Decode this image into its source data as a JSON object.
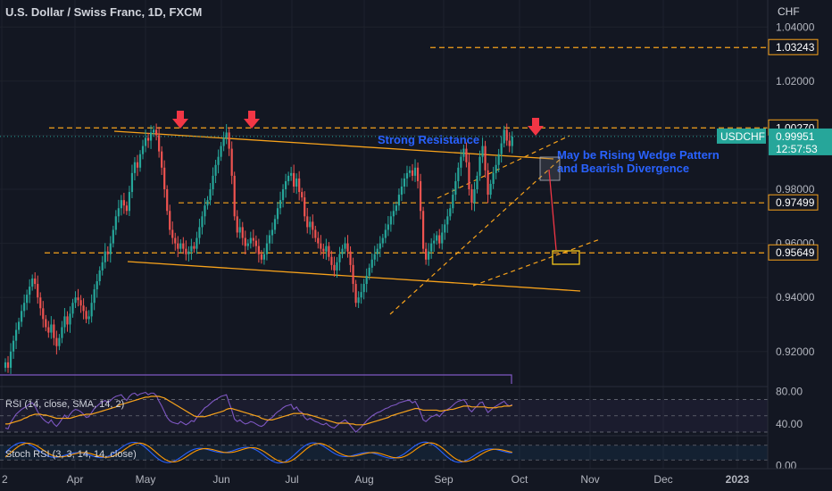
{
  "header": {
    "symbol_title": "U.S. Dollar / Swiss Franc, 1D, FXCM",
    "currency": "CHF"
  },
  "colors": {
    "up": "#26a69a",
    "down": "#ef5350",
    "orange": "#f7a21b",
    "blue_text": "#2962ff",
    "bg": "#131722"
  },
  "chart_data": {
    "type": "candlestick",
    "ylim": [
      0.912,
      1.05
    ],
    "y_ticks": [
      "1.04000",
      "1.02000",
      "1.00000",
      "0.98000",
      "0.96000",
      "0.94000",
      "0.92000"
    ],
    "x_ticks": [
      "2",
      "Apr",
      "May",
      "Jun",
      "Jul",
      "Aug",
      "Sep",
      "Oct",
      "Nov",
      "Dec",
      "2023"
    ],
    "price_labels": [
      {
        "value": 1.03243,
        "text": "1.03243",
        "style": "orange"
      },
      {
        "value": 1.0027,
        "text": "1.00270",
        "style": "orange"
      },
      {
        "value": 0.97499,
        "text": "0.97499",
        "style": "orange"
      },
      {
        "value": 0.95649,
        "text": "0.95649",
        "style": "orange"
      }
    ],
    "current": {
      "symbol": "USDCHF",
      "price": "0.99951",
      "countdown": "12:57:53",
      "value": 0.99951
    },
    "horizontal_levels": [
      1.03243,
      1.0027,
      0.97499,
      0.95649
    ],
    "annotations": {
      "strong_resistance": "Strong Resistance",
      "wedge_line1": "May be Rising Wedge Pattern",
      "wedge_line2": "and Bearish Divergence"
    },
    "arrows_down_at": [
      "May",
      "Jun",
      "Oct"
    ],
    "closes": [
      0.916,
      0.914,
      0.92,
      0.924,
      0.928,
      0.931,
      0.935,
      0.938,
      0.941,
      0.944,
      0.947,
      0.945,
      0.94,
      0.936,
      0.932,
      0.929,
      0.927,
      0.93,
      0.925,
      0.922,
      0.925,
      0.929,
      0.933,
      0.93,
      0.934,
      0.938,
      0.94,
      0.939,
      0.937,
      0.935,
      0.932,
      0.933,
      0.938,
      0.943,
      0.946,
      0.95,
      0.953,
      0.957,
      0.956,
      0.96,
      0.965,
      0.97,
      0.973,
      0.976,
      0.974,
      0.972,
      0.979,
      0.986,
      0.99,
      0.988,
      0.993,
      0.996,
      0.999,
      0.998,
      1.001,
      1.002,
      1.0,
      0.994,
      0.988,
      0.98,
      0.972,
      0.965,
      0.962,
      0.96,
      0.958,
      0.96,
      0.958,
      0.956,
      0.957,
      0.959,
      0.958,
      0.962,
      0.966,
      0.97,
      0.974,
      0.976,
      0.98,
      0.985,
      0.989,
      0.992,
      0.996,
      0.999,
      1.001,
      0.995,
      0.985,
      0.97,
      0.964,
      0.966,
      0.962,
      0.959,
      0.96,
      0.962,
      0.961,
      0.959,
      0.956,
      0.954,
      0.956,
      0.96,
      0.963,
      0.965,
      0.969,
      0.973,
      0.976,
      0.98,
      0.983,
      0.985,
      0.986,
      0.981,
      0.984,
      0.979,
      0.977,
      0.97,
      0.966,
      0.968,
      0.965,
      0.962,
      0.96,
      0.958,
      0.957,
      0.959,
      0.955,
      0.952,
      0.95,
      0.953,
      0.956,
      0.958,
      0.96,
      0.957,
      0.952,
      0.945,
      0.938,
      0.94,
      0.942,
      0.945,
      0.948,
      0.951,
      0.954,
      0.956,
      0.958,
      0.96,
      0.962,
      0.965,
      0.967,
      0.97,
      0.972,
      0.974,
      0.978,
      0.981,
      0.984,
      0.986,
      0.987,
      0.985,
      0.988,
      0.983,
      0.972,
      0.958,
      0.954,
      0.957,
      0.96,
      0.961,
      0.963,
      0.96,
      0.964,
      0.967,
      0.97,
      0.973,
      0.978,
      0.983,
      0.988,
      0.992,
      0.995,
      0.99,
      0.98,
      0.975,
      0.98,
      0.985,
      0.992,
      0.996,
      0.987,
      0.978,
      0.982,
      0.986,
      0.989,
      0.993,
      0.997,
      1.002,
      0.998,
      0.996,
      0.9995
    ],
    "rsi": {
      "label": "RSI (14, close, SMA, 14, 2)",
      "ylim": [
        30,
        85
      ],
      "ticks": [
        "80.00",
        "40.00"
      ],
      "values": [
        35,
        34,
        42,
        47,
        52,
        55,
        58,
        60,
        62,
        65,
        66,
        62,
        55,
        50,
        46,
        43,
        41,
        45,
        40,
        37,
        41,
        46,
        51,
        47,
        52,
        56,
        58,
        57,
        55,
        52,
        48,
        49,
        54,
        59,
        62,
        65,
        67,
        69,
        66,
        69,
        72,
        74,
        75,
        76,
        72,
        69,
        74,
        77,
        78,
        75,
        77,
        78,
        79,
        76,
        78,
        78,
        75,
        68,
        62,
        55,
        48,
        44,
        42,
        41,
        40,
        43,
        41,
        39,
        41,
        44,
        43,
        48,
        52,
        56,
        60,
        62,
        65,
        68,
        70,
        72,
        74,
        75,
        76,
        66,
        57,
        46,
        43,
        45,
        42,
        40,
        41,
        43,
        42,
        40,
        38,
        37,
        39,
        43,
        46,
        48,
        52,
        55,
        57,
        60,
        62,
        63,
        64,
        58,
        61,
        56,
        54,
        48,
        45,
        47,
        45,
        43,
        42,
        40,
        39,
        41,
        38,
        36,
        35,
        38,
        41,
        43,
        45,
        42,
        38,
        34,
        30,
        33,
        36,
        40,
        44,
        47,
        50,
        52,
        54,
        55,
        57,
        59,
        60,
        62,
        63,
        64,
        66,
        67,
        68,
        69,
        69,
        66,
        68,
        62,
        54,
        45,
        43,
        46,
        49,
        50,
        52,
        49,
        53,
        56,
        58,
        60,
        63,
        66,
        68,
        69,
        70,
        66,
        58,
        55,
        59,
        62,
        66,
        67,
        60,
        54,
        57,
        60,
        62,
        64,
        66,
        68,
        64,
        62,
        64
      ],
      "ma": [
        40,
        40,
        41,
        42,
        43,
        44,
        45,
        47,
        48,
        50,
        51,
        52,
        52,
        52,
        51,
        51,
        50,
        49,
        48,
        47,
        47,
        47,
        47,
        47,
        47,
        48,
        49,
        50,
        51,
        51,
        52,
        52,
        52,
        53,
        54,
        55,
        56,
        57,
        58,
        59,
        60,
        61,
        63,
        64,
        65,
        66,
        67,
        68,
        69,
        70,
        71,
        72,
        73,
        73,
        74,
        74,
        74,
        74,
        73,
        72,
        70,
        68,
        66,
        64,
        62,
        60,
        58,
        56,
        54,
        52,
        50,
        49,
        49,
        49,
        49,
        50,
        51,
        52,
        53,
        54,
        55,
        56,
        58,
        59,
        59,
        58,
        57,
        56,
        55,
        54,
        53,
        52,
        51,
        50,
        49,
        47,
        46,
        45,
        45,
        45,
        46,
        47,
        48,
        49,
        50,
        51,
        52,
        53,
        53,
        53,
        53,
        52,
        52,
        51,
        50,
        49,
        48,
        47,
        46,
        45,
        44,
        43,
        42,
        41,
        41,
        41,
        41,
        41,
        40,
        40,
        39,
        39,
        39,
        39,
        40,
        41,
        42,
        43,
        44,
        45,
        46,
        47,
        48,
        50,
        51,
        52,
        53,
        54,
        55,
        56,
        57,
        58,
        59,
        59,
        58,
        57,
        57,
        57,
        57,
        57,
        57,
        56,
        56,
        57,
        57,
        58,
        58,
        59,
        60,
        61,
        62,
        62,
        62,
        61,
        61,
        61,
        61,
        61,
        61,
        60,
        60,
        60,
        60,
        61,
        61,
        62,
        62,
        62,
        63
      ]
    },
    "stoch": {
      "label": "Stoch RSI (3, 3, 14, 14, close)",
      "ylim": [
        -5,
        105
      ],
      "tick": "0.00"
    }
  }
}
